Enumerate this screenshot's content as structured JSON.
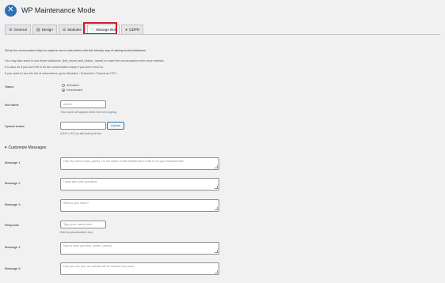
{
  "header": {
    "title": "WP Maintenance Mode",
    "logo_icon": "wrench-screwdriver-icon"
  },
  "tabs": [
    {
      "label": "General",
      "icon": "gear-icon"
    },
    {
      "label": "Design",
      "icon": "paintbrush-icon"
    },
    {
      "label": "Modules",
      "icon": "list-icon"
    },
    {
      "label": "Manage Bot",
      "icon": "heart-icon",
      "active": true
    },
    {
      "label": "GDPR",
      "icon": "lock-icon"
    }
  ],
  "highlight_color": "#d01c2a",
  "intro": {
    "heading": "Setup the conversation steps to capture more subscribers with this friendly way of asking email addresses.",
    "line1": "You may also want to use these wildcards: {bot_name} and {visitor_name} to make the conversation even more realistic.",
    "line2": "It is also ok if you don't fill in all the conversation steps if you don't need to.",
    "line3": "If you want to see the list of subscribers, go to Modules › Subscribe › Export as CSV."
  },
  "status": {
    "label": "Status",
    "option_activated": "Activated",
    "option_deactivated": "Deactivated",
    "selected": "Deactivated"
  },
  "bot_name": {
    "label": "Bot Name",
    "value": "Admin",
    "help": "This name will appear when the bot is typing."
  },
  "avatar": {
    "label": "Upload avatar",
    "button": "Upload",
    "help": "A 512 x 512 px will work just fine."
  },
  "customize": {
    "label": "Customize Messages"
  },
  "messages": [
    {
      "label": "Message 1",
      "text": "Hey! My name is {bot_name}, I'm the owner of this website and I'd like to be your assistant here."
    },
    {
      "label": "Message 2",
      "text": "I have just a few questions."
    },
    {
      "label": "Message 3",
      "text": "What is your name?"
    },
    {
      "label": "Message 4",
      "text": "Nice to meet you here, {visitor_name}!"
    },
    {
      "label": "Message 5",
      "text": "How you can see, our website will be lauched very soon."
    }
  ],
  "response": {
    "label": "Response",
    "placeholder": "Type your name here...",
    "help": "Edit the placeholder's text"
  }
}
